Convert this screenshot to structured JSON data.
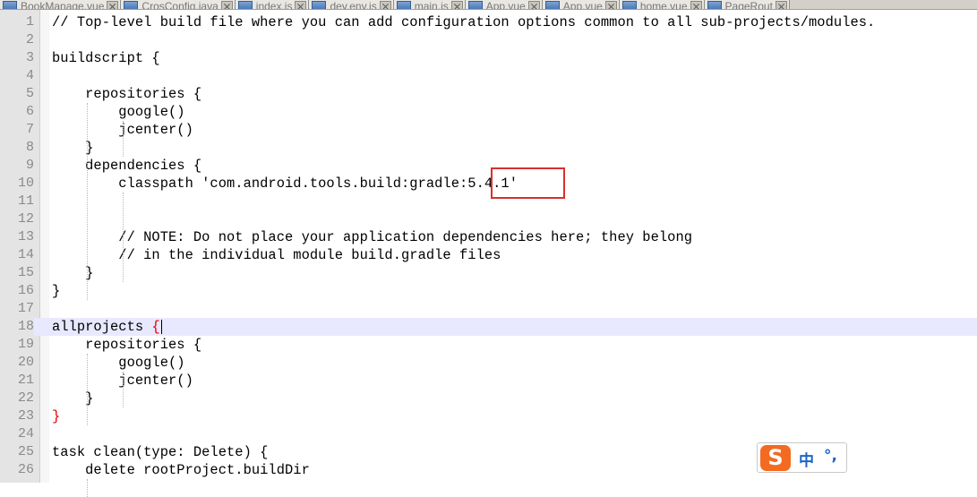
{
  "tabs": [
    {
      "label": "BookManage.vue"
    },
    {
      "label": "CrosConfig.java"
    },
    {
      "label": "index.js"
    },
    {
      "label": "dev.env.js"
    },
    {
      "label": "main.js"
    },
    {
      "label": "App.vue"
    },
    {
      "label": "App.vue"
    },
    {
      "label": "home.vue"
    },
    {
      "label": "PageRout"
    }
  ],
  "editor": {
    "current_line": 18,
    "lines": [
      {
        "n": "1",
        "text": "// Top-level build file where you can add configuration options common to all sub-projects/modules."
      },
      {
        "n": "2",
        "text": ""
      },
      {
        "n": "3",
        "text": "buildscript {"
      },
      {
        "n": "4",
        "text": ""
      },
      {
        "n": "5",
        "text": "    repositories {"
      },
      {
        "n": "6",
        "text": "        google()"
      },
      {
        "n": "7",
        "text": "        jcenter()"
      },
      {
        "n": "8",
        "text": "    }"
      },
      {
        "n": "9",
        "text": "    dependencies {"
      },
      {
        "n": "10",
        "text": "        classpath 'com.android.tools.build:gradle:5.4.1'"
      },
      {
        "n": "11",
        "text": ""
      },
      {
        "n": "12",
        "text": ""
      },
      {
        "n": "13",
        "text": "        // NOTE: Do not place your application dependencies here; they belong"
      },
      {
        "n": "14",
        "text": "        // in the individual module build.gradle files"
      },
      {
        "n": "15",
        "text": "    }"
      },
      {
        "n": "16",
        "text": "}"
      },
      {
        "n": "17",
        "text": ""
      },
      {
        "n": "18",
        "text": "allprojects ",
        "brace": "{"
      },
      {
        "n": "19",
        "text": "    repositories {"
      },
      {
        "n": "20",
        "text": "        google()"
      },
      {
        "n": "21",
        "text": "        jcenter()"
      },
      {
        "n": "22",
        "text": "    }"
      },
      {
        "n": "23",
        "text": "",
        "brace": "}"
      },
      {
        "n": "24",
        "text": ""
      },
      {
        "n": "25",
        "text": "task clean(type: Delete) {"
      },
      {
        "n": "26",
        "text": "    delete rootProject.buildDir"
      }
    ]
  },
  "ime": {
    "logo": "S",
    "mode": "中",
    "punct": "°,"
  },
  "colors": {
    "highlight_box": "#d9302c",
    "matched_brace": "#e00000",
    "current_line_bg": "#e8e8ff",
    "ime_logo": "#f26b21"
  }
}
